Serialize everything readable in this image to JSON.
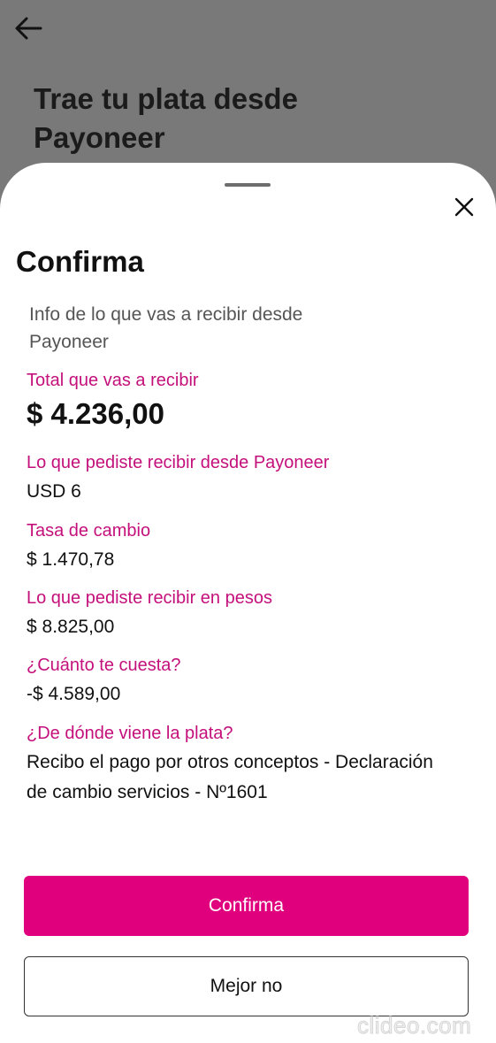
{
  "background": {
    "title": "Trae tu plata desde Payoneer",
    "back_icon": "arrow-left-icon"
  },
  "sheet": {
    "close_icon": "close-icon",
    "title": "Confirma",
    "subtitle": "Info de lo que vas a recibir desde Payoneer",
    "total": {
      "label": "Total que vas a recibir",
      "value": "$ 4.236,00"
    },
    "fields": [
      {
        "label": "Lo que pediste recibir desde Payoneer",
        "value": "USD 6"
      },
      {
        "label": "Tasa de cambio",
        "value": "$ 1.470,78"
      },
      {
        "label": "Lo que pediste recibir en pesos",
        "value": "$ 8.825,00"
      },
      {
        "label": "¿Cuánto te cuesta?",
        "value": "-$ 4.589,00"
      }
    ],
    "source": {
      "label": "¿De dónde viene la plata?",
      "value": "Recibo el pago por otros conceptos - Declaración de cambio servicios - Nº1601"
    },
    "confirm_label": "Confirma",
    "cancel_label": "Mejor no"
  },
  "watermark": "clideo.com",
  "colors": {
    "accent": "#e0007e",
    "label": "#c4107b",
    "overlay": "#7a797a"
  }
}
